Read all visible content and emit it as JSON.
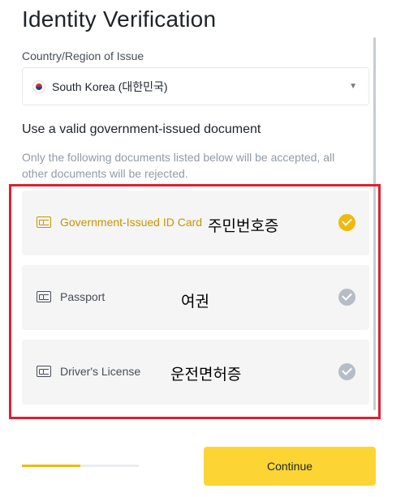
{
  "page": {
    "title": "Identity Verification"
  },
  "country": {
    "label": "Country/Region of Issue",
    "value": "South Korea (대한민국)",
    "flag_icon": "south-korea-flag-icon"
  },
  "documents": {
    "heading": "Use a valid government-issued document",
    "note": "Only the following documents listed below will be accepted, all other documents will be rejected.",
    "items": [
      {
        "label": "Government-Issued ID Card",
        "annotation": "주민번호증",
        "selected": true,
        "icon": "id-card-icon"
      },
      {
        "label": "Passport",
        "annotation": "여권",
        "selected": false,
        "icon": "passport-icon"
      },
      {
        "label": "Driver's License",
        "annotation": "운전면허증",
        "selected": false,
        "icon": "drivers-license-icon"
      }
    ]
  },
  "progress": {
    "value": 0.5
  },
  "footer": {
    "continue_label": "Continue"
  },
  "colors": {
    "accent": "#F0B90B",
    "button": "#FCD535",
    "highlight_border": "#E0202E",
    "selected_text": "#C99400"
  }
}
